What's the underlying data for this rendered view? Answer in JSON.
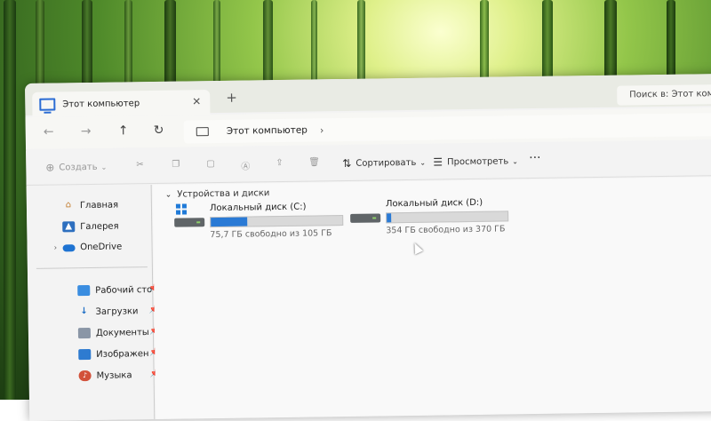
{
  "tab": {
    "title": "Этот компьютер",
    "close": "✕",
    "new_tab": "+"
  },
  "search": {
    "placeholder": "Поиск в: Этот компьютер"
  },
  "nav": {
    "back": "←",
    "forward": "→",
    "up": "↑",
    "refresh": "↻"
  },
  "address": {
    "path": "Этот компьютер",
    "chevron": "›"
  },
  "toolbar": {
    "create_label": "Создать",
    "sort_label": "Сортировать",
    "view_label": "Просмотреть",
    "more": "···"
  },
  "sidebar": {
    "items": [
      {
        "label": "Главная",
        "icon": "home-icon"
      },
      {
        "label": "Галерея",
        "icon": "gallery-icon"
      },
      {
        "label": "OneDrive",
        "icon": "cloud-icon"
      }
    ],
    "quick": [
      {
        "label": "Рабочий сто",
        "icon": "desktop-icon"
      },
      {
        "label": "Загрузки",
        "icon": "download-icon"
      },
      {
        "label": "Документы",
        "icon": "documents-icon"
      },
      {
        "label": "Изображен",
        "icon": "pictures-icon"
      },
      {
        "label": "Музыка",
        "icon": "music-icon"
      }
    ]
  },
  "content": {
    "group_title": "Устройства и диски",
    "drives": [
      {
        "name": "Локальный диск (C:)",
        "free_text": "75,7 ГБ свободно из 105 ГБ",
        "used_fraction": 0.28
      },
      {
        "name": "Локальный диск (D:)",
        "free_text": "354 ГБ свободно из 370 ГБ",
        "used_fraction": 0.04
      }
    ]
  },
  "colors": {
    "accent": "#2a7ad5",
    "window_bg": "#f3f3f3"
  }
}
